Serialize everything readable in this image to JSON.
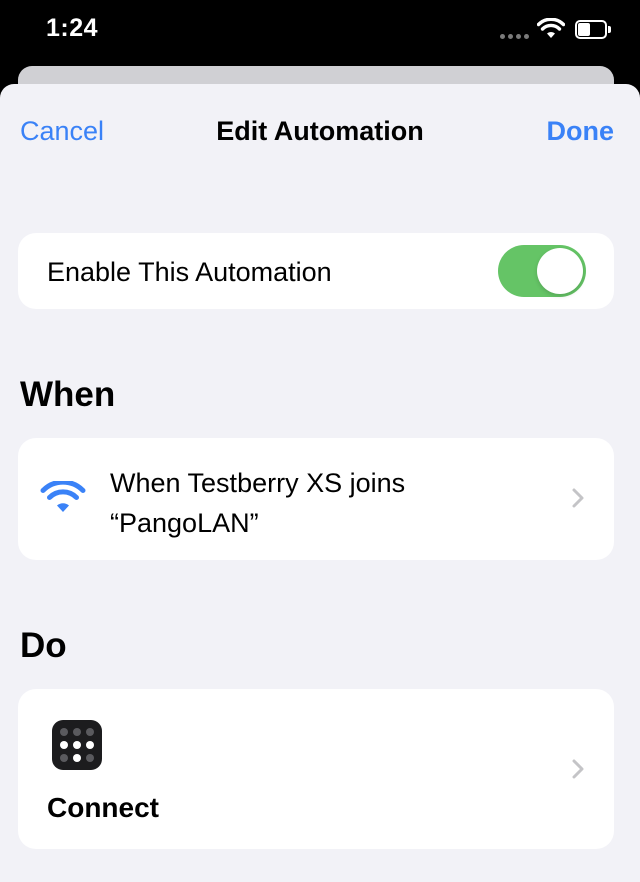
{
  "status_bar": {
    "time": "1:24",
    "icons": [
      "signal-dots-icon",
      "wifi-icon",
      "battery-icon"
    ]
  },
  "nav": {
    "cancel_label": "Cancel",
    "title": "Edit Automation",
    "done_label": "Done"
  },
  "enable": {
    "label": "Enable This Automation",
    "enabled": true
  },
  "when": {
    "header": "When",
    "trigger_line1": "When Testberry XS joins",
    "trigger_line2": "“PangoLAN”",
    "icon": "wifi-icon"
  },
  "do": {
    "header": "Do",
    "action_label": "Connect",
    "icon": "keypad-icon"
  },
  "colors": {
    "accent": "#3a82f7",
    "toggle_on": "#65c466",
    "background": "#f2f2f7",
    "card": "#ffffff"
  }
}
